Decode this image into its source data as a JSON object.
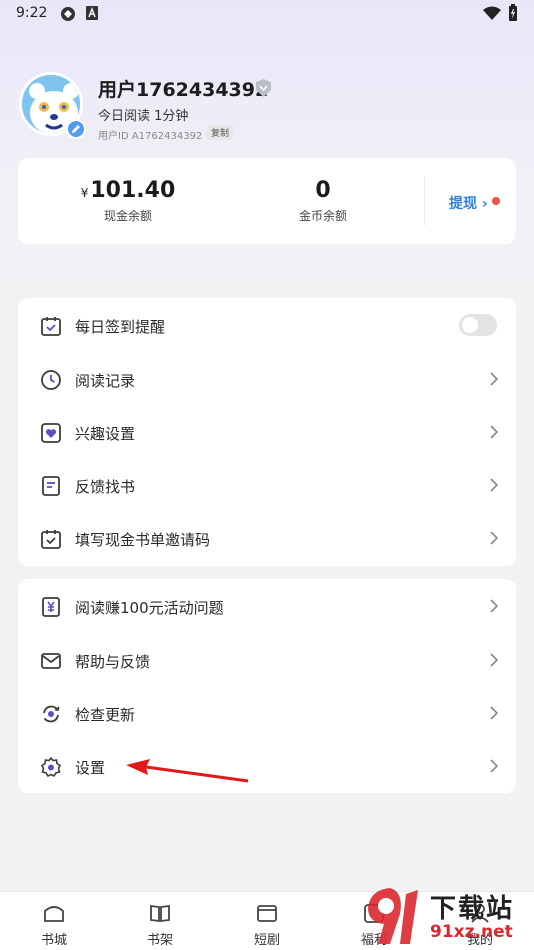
{
  "status_bar": {
    "time": "9:22"
  },
  "profile": {
    "username": "用户1762434392",
    "read_today": "今日阅读 1分钟",
    "user_id": "用户ID A1762434392",
    "copy_label": "复制"
  },
  "balance": {
    "cash_currency": "¥",
    "cash_value": "101.40",
    "cash_label": "现金余额",
    "coin_value": "0",
    "coin_label": "金币余额",
    "withdraw_label": "提现",
    "withdraw_chevron": "›"
  },
  "menu_group_1": [
    {
      "label": "每日签到提醒",
      "icon": "calendar-check-icon",
      "control": "toggle",
      "toggle_on": false
    },
    {
      "label": "阅读记录",
      "icon": "clock-icon",
      "control": "chevron"
    },
    {
      "label": "兴趣设置",
      "icon": "heart-box-icon",
      "control": "chevron"
    },
    {
      "label": "反馈找书",
      "icon": "document-icon",
      "control": "chevron"
    },
    {
      "label": "填写现金书单邀请码",
      "icon": "calendar-check-icon",
      "control": "chevron"
    }
  ],
  "menu_group_2": [
    {
      "label": "阅读赚100元活动问题",
      "icon": "yuan-note-icon",
      "control": "chevron"
    },
    {
      "label": "帮助与反馈",
      "icon": "mail-icon",
      "control": "chevron"
    },
    {
      "label": "检查更新",
      "icon": "refresh-icon",
      "control": "chevron"
    },
    {
      "label": "设置",
      "icon": "gear-icon",
      "control": "chevron"
    }
  ],
  "bottom_nav": [
    {
      "label": "书城",
      "icon": "bookstore-icon"
    },
    {
      "label": "书架",
      "icon": "bookshelf-icon"
    },
    {
      "label": "短剧",
      "icon": "short-drama-icon"
    },
    {
      "label": "福利",
      "icon": "welfare-icon"
    },
    {
      "label": "我的",
      "icon": "profile-icon"
    }
  ],
  "watermark": {
    "line1": "下载站",
    "line2": "91xz.net"
  },
  "colors": {
    "accent": "#2f7fdd",
    "icon_purple": "#5b4fc7",
    "annotation_red": "#e01818"
  }
}
